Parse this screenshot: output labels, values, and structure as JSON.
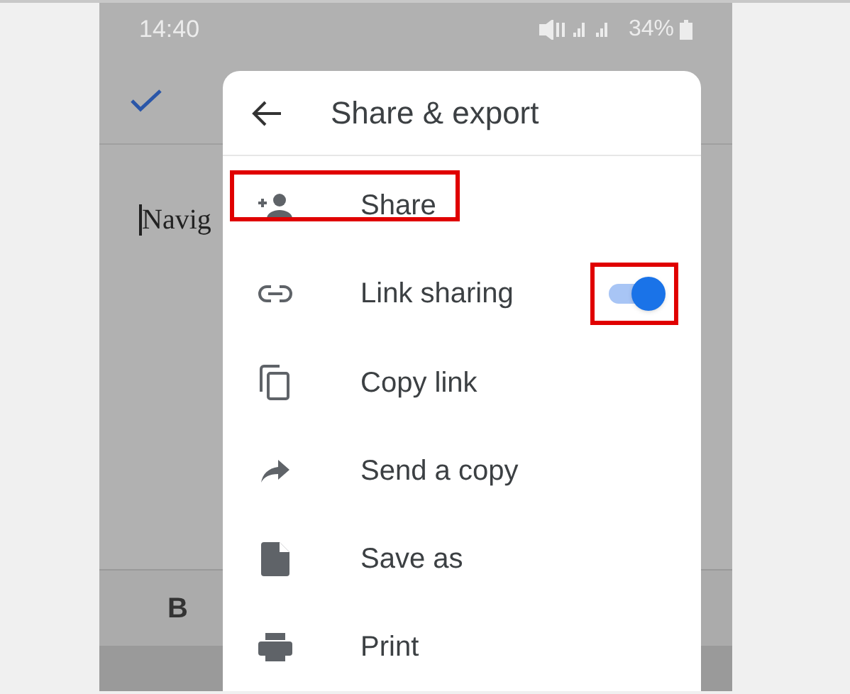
{
  "status_bar": {
    "time": "14:40",
    "battery": "34%"
  },
  "document": {
    "text": "Navig",
    "toolbar_button": "B"
  },
  "menu": {
    "title": "Share & export",
    "items": [
      {
        "label": "Share",
        "kind": "share",
        "highlighted": true
      },
      {
        "label": "Link sharing",
        "kind": "link",
        "toggle": {
          "on": true,
          "highlighted": true
        }
      },
      {
        "label": "Copy link",
        "kind": "copy"
      },
      {
        "label": "Send a copy",
        "kind": "send"
      },
      {
        "label": "Save as",
        "kind": "file"
      },
      {
        "label": "Print",
        "kind": "print"
      }
    ]
  }
}
